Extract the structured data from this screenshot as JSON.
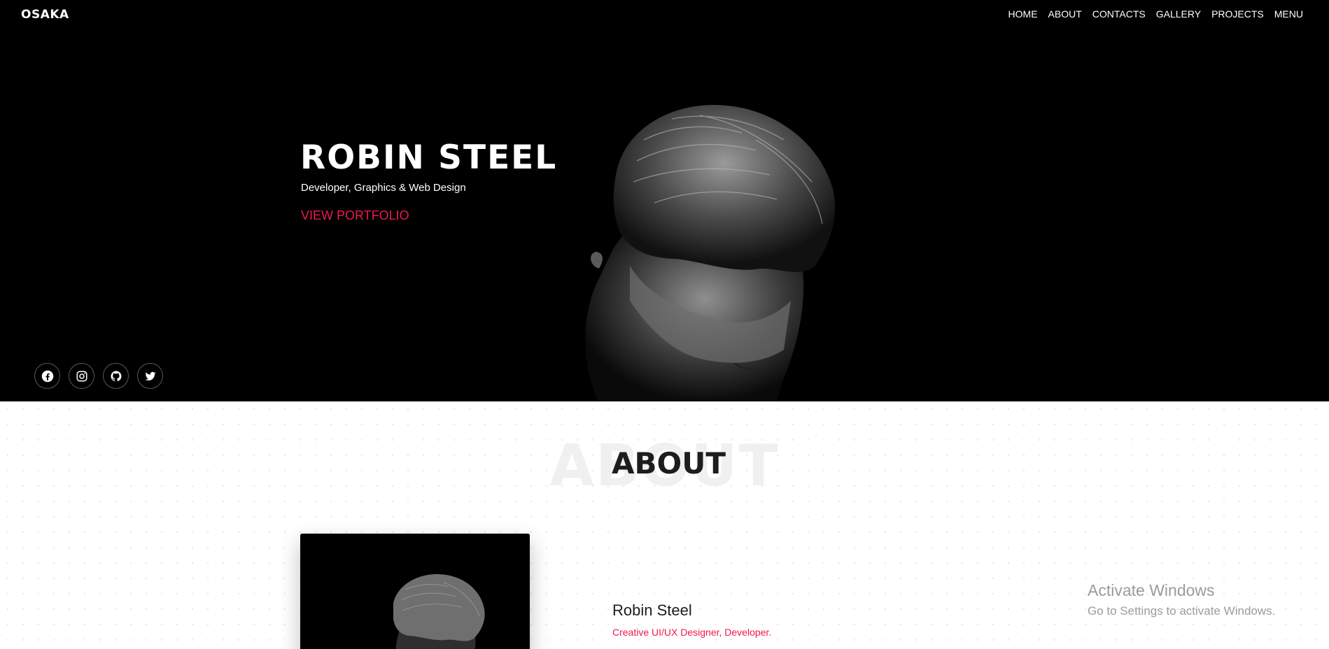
{
  "brand": "OSAKA",
  "nav": [
    "HOME",
    "ABOUT",
    "CONTACTS",
    "GALLERY",
    "PROJECTS",
    "MENU"
  ],
  "hero": {
    "title": "ROBIN STEEL",
    "subtitle": "Developer, Graphics & Web Design",
    "cta": "VIEW PORTFOLIO"
  },
  "socials": [
    "facebook-icon",
    "instagram-icon",
    "github-icon",
    "twitter-icon"
  ],
  "about": {
    "heading": "ABOUT",
    "background_word": "ABOUT",
    "name": "Robin Steel",
    "role": "Creative UI/UX Designer, Developer."
  },
  "watermark": {
    "title": "Activate Windows",
    "subtitle": "Go to Settings to activate Windows."
  },
  "colors": {
    "accent": "#f0174f",
    "hero_background": "#000000",
    "text_dark": "#1d1d1f"
  }
}
